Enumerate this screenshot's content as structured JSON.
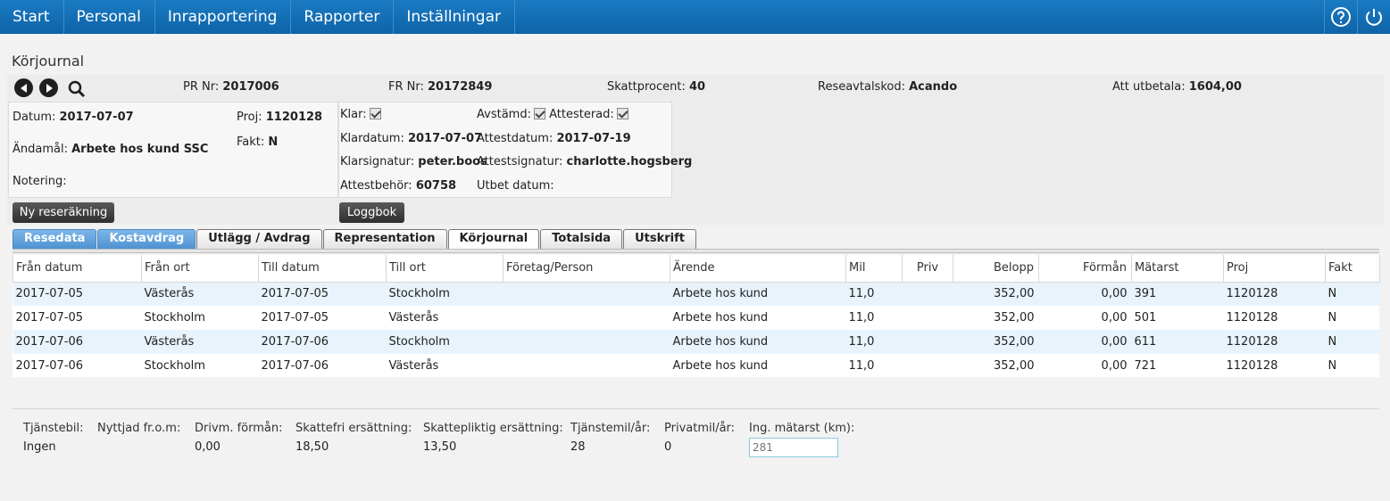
{
  "nav": {
    "items": [
      "Start",
      "Personal",
      "Inrapportering",
      "Rapporter",
      "Inställningar"
    ],
    "help_icon": "help-icon",
    "power_icon": "power-icon"
  },
  "page": {
    "title": "Körjournal"
  },
  "header": {
    "pr_label": "PR Nr:",
    "pr_value": "2017006",
    "fr_label": "FR Nr:",
    "fr_value": "20172849",
    "skatt_label": "Skattprocent:",
    "skatt_value": "40",
    "avtal_label": "Reseavtalskod:",
    "avtal_value": "Acando",
    "utbetala_label": "Att utbetala:",
    "utbetala_value": "1604,00"
  },
  "details": {
    "datum_label": "Datum:",
    "datum_value": "2017-07-07",
    "proj_label": "Proj:",
    "proj_value": "1120128",
    "fakt_label": "Fakt:",
    "fakt_value": "N",
    "andamal_label": "Ändamål:",
    "andamal_value": "Arbete hos kund SSC",
    "notering_label": "Notering:"
  },
  "status": {
    "klar_label": "Klar:",
    "avstamd_label": "Avstämd:",
    "attesterad_label": "Attesterad:",
    "klardatum_label": "Klardatum:",
    "klardatum_value": "2017-07-07",
    "attestdatum_label": "Attestdatum:",
    "attestdatum_value": "2017-07-19",
    "klarsignatur_label": "Klarsignatur:",
    "klarsignatur_value": "peter.boos",
    "attestsignatur_label": "Attestsignatur:",
    "attestsignatur_value": "charlotte.hogsberg",
    "attestbehor_label": "Attestbehör:",
    "attestbehor_value": "60758",
    "utbet_datum_label": "Utbet datum:"
  },
  "buttons": {
    "ny_reserakning": "Ny reseräkning",
    "loggbok": "Loggbok"
  },
  "tabs": [
    "Resedata",
    "Kostavdrag",
    "Utlägg / Avdrag",
    "Representation",
    "Körjournal",
    "Totalsida",
    "Utskrift"
  ],
  "table": {
    "columns": [
      "Från datum",
      "Från ort",
      "Till datum",
      "Till ort",
      "Företag/Person",
      "Ärende",
      "Mil",
      "Priv",
      "Belopp",
      "Förmån",
      "Mätarst",
      "Proj",
      "Fakt"
    ],
    "rows": [
      [
        "2017-07-05",
        "Västerås",
        "2017-07-05",
        "Stockholm",
        "",
        "Arbete hos kund",
        "11,0",
        "",
        "352,00",
        "0,00",
        "391",
        "1120128",
        "N"
      ],
      [
        "2017-07-05",
        "Stockholm",
        "2017-07-05",
        "Västerås",
        "",
        "Arbete hos kund",
        "11,0",
        "",
        "352,00",
        "0,00",
        "501",
        "1120128",
        "N"
      ],
      [
        "2017-07-06",
        "Västerås",
        "2017-07-06",
        "Stockholm",
        "",
        "Arbete hos kund",
        "11,0",
        "",
        "352,00",
        "0,00",
        "611",
        "1120128",
        "N"
      ],
      [
        "2017-07-06",
        "Stockholm",
        "2017-07-06",
        "Västerås",
        "",
        "Arbete hos kund",
        "11,0",
        "",
        "352,00",
        "0,00",
        "721",
        "1120128",
        "N"
      ]
    ]
  },
  "summary": {
    "tjanstebil_label": "Tjänstebil:",
    "tjanstebil_value": "Ingen",
    "nyttjad_label": "Nyttjad fr.o.m:",
    "drivm_label": "Drivm. förmån:",
    "drivm_value": "0,00",
    "skattefri_label": "Skattefri ersättning:",
    "skattefri_value": "18,50",
    "skattepliktig_label": "Skattepliktig ersättning:",
    "skattepliktig_value": "13,50",
    "tjanstemil_label": "Tjänstemil/år:",
    "tjanstemil_value": "28",
    "privatmil_label": "Privatmil/år:",
    "privatmil_value": "0",
    "ing_matarst_label": "Ing. mätarst (km):",
    "ing_matarst_placeholder": "281"
  }
}
